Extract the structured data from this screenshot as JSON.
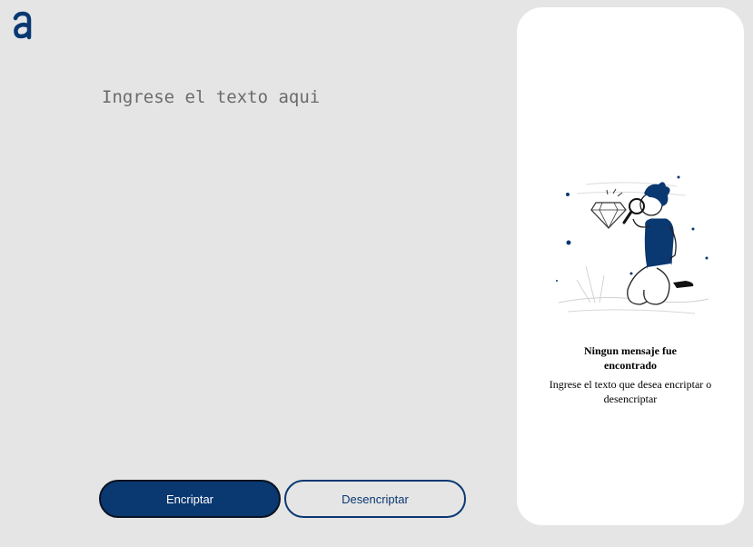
{
  "input": {
    "placeholder": "Ingrese el texto aqui"
  },
  "buttons": {
    "encrypt_label": "Encriptar",
    "decrypt_label": "Desencriptar"
  },
  "output_panel": {
    "title": "Ningun mensaje fue encontrado",
    "subtitle": "Ingrese el texto que desea encriptar o desencriptar",
    "illustration": "boy-with-magnifying-glass-and-diamond"
  },
  "colors": {
    "background": "#e5e5e5",
    "accent": "#0a3871",
    "panel": "#ffffff"
  }
}
